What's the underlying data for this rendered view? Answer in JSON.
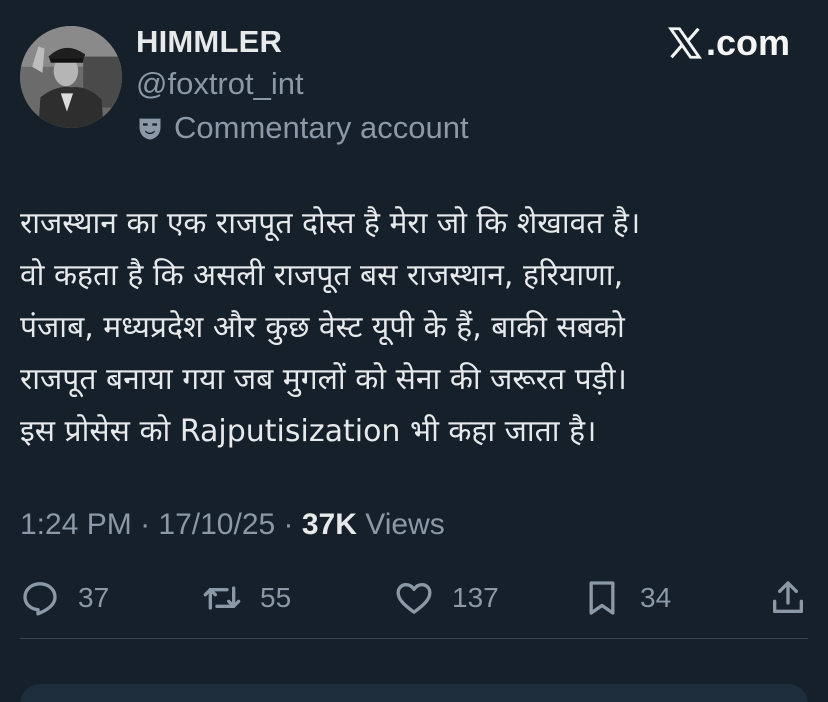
{
  "author": {
    "display_name": "HIMMLER",
    "handle": "@foxtrot_int",
    "label": "Commentary account",
    "label_icon": "theater-mask-icon",
    "avatar": "profile-avatar"
  },
  "brand": {
    "text": ".com",
    "icon": "x-logo-icon"
  },
  "tweet": {
    "lines": [
      "राजस्थान का एक राजपूत दोस्त है मेरा जो कि शेखावत है।",
      "वो कहता है कि असली राजपूत बस राजस्थान, हरियाणा,",
      "पंजाब, मध्यप्रदेश और कुछ वेस्ट यूपी के हैं, बाकी सबको",
      "राजपूत बनाया गया जब मुगलों को सेना की जरूरत पड़ी।",
      "इस प्रोसेस को Rajputisization भी कहा जाता है।"
    ]
  },
  "meta": {
    "time": "1:24 PM",
    "sep1": " · ",
    "date": "17/10/25",
    "sep2": " · ",
    "views_count": "37K",
    "views_label": " Views"
  },
  "actions": {
    "replies": "37",
    "reposts": "55",
    "likes": "137",
    "bookmarks": "34"
  },
  "colors": {
    "background": "#15202b",
    "text": "#e7e9ea",
    "secondary": "#8b98a5",
    "divider": "#38444d"
  }
}
